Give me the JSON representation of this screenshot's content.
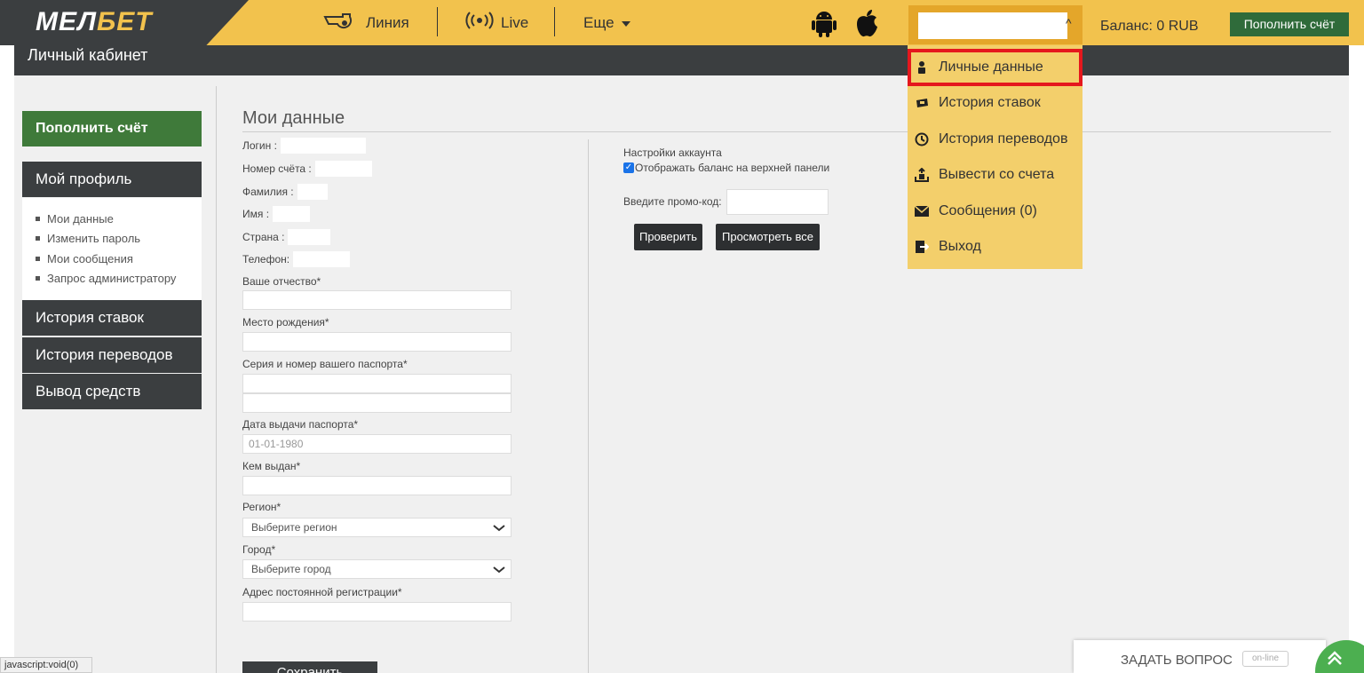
{
  "header": {
    "logo_part1": "МЕЛ",
    "logo_part2": "БЕТ",
    "nav": [
      {
        "label": "Линия",
        "icon": "whistle-icon"
      },
      {
        "label": "Live",
        "icon": "live-broadcast-icon"
      },
      {
        "label": "Еще",
        "icon": "caret-down-icon"
      }
    ],
    "os_icons": [
      "android-icon",
      "apple-icon"
    ],
    "account_value": "",
    "account_caret": "^",
    "balance": "Баланс: 0 RUB",
    "topup_label": "Пополнить счёт"
  },
  "cabinet_title": "Личный кабинет",
  "sidebar": {
    "topup_label": "Пополнить счёт",
    "profile_label": "Мой профиль",
    "profile_items": [
      "Мои данные",
      "Изменить пароль",
      "Мои сообщения",
      "Запрос администратору"
    ],
    "bets_history": "История ставок",
    "transfers_history": "История переводов",
    "withdraw": "Вывод средств"
  },
  "my_data": {
    "title": "Мои данные",
    "info": [
      {
        "label": "Логин :"
      },
      {
        "label": "Номер счёта :"
      },
      {
        "label": "Фамилия :"
      },
      {
        "label": "Имя :"
      },
      {
        "label": "Страна :"
      },
      {
        "label": "Телефон:"
      }
    ],
    "patronymic_label": "Ваше отчество*",
    "birthplace_label": "Место рождения*",
    "passport_label": "Серия и номер вашего паспорта*",
    "issue_date_label": "Дата выдачи паспорта*",
    "issue_date_placeholder": "01-01-1980",
    "issued_by_label": "Кем выдан*",
    "region_label": "Регион*",
    "region_value": "Выберите регион",
    "city_label": "Город*",
    "city_value": "Выберите город",
    "address_label": "Адрес постоянной регистрации*",
    "save_label": "Сохранить"
  },
  "settings": {
    "title": "Настройки аккаунта",
    "show_balance_label": "Отображать баланс на верхней панели",
    "show_balance_checked": true,
    "promo_label": "Введите промо-код:",
    "check_label": "Проверить",
    "view_all_label": "Просмотреть все"
  },
  "dropdown": {
    "items": [
      {
        "label": "Личные данные",
        "icon": "person-icon"
      },
      {
        "label": "История ставок",
        "icon": "ticket-icon"
      },
      {
        "label": "История переводов",
        "icon": "clock-icon"
      },
      {
        "label": "Вывести со счета",
        "icon": "withdraw-icon"
      },
      {
        "label": "Сообщения (0)",
        "icon": "envelope-icon"
      },
      {
        "label": "Выход",
        "icon": "exit-icon"
      }
    ]
  },
  "status_bar": "javascript:void(0)",
  "chat": {
    "label": "ЗАДАТЬ ВОПРОС",
    "badge": "on-line"
  },
  "colors": {
    "brand_yellow": "#f2c24d",
    "dark": "#3b3e40",
    "green": "#3f7a3a",
    "highlight_red": "#e5171d"
  }
}
